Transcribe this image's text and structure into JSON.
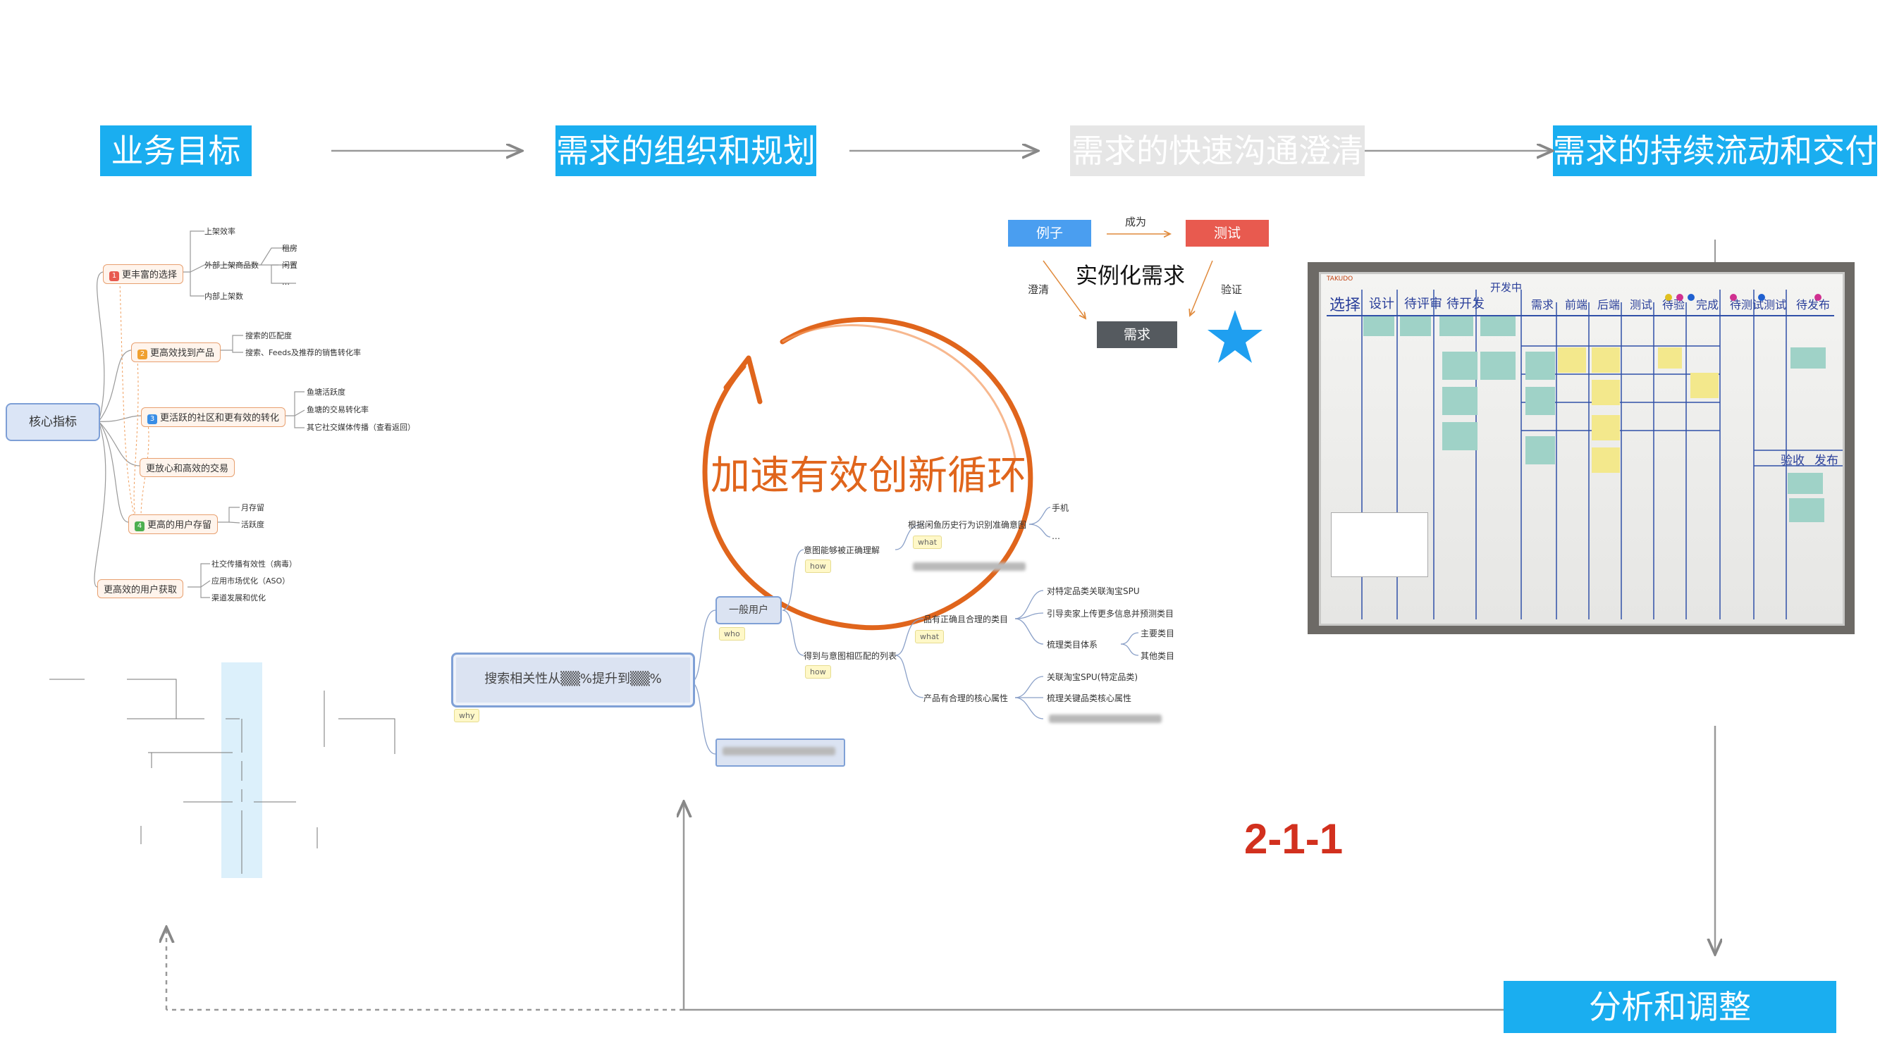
{
  "stages": {
    "s1": "业务目标",
    "s2": "需求的组织和规划",
    "s3": "需求的快速沟通澄清",
    "s4": "需求的持续流动和交付",
    "s5": "分析和调整"
  },
  "cycle_label": "加速有效创新循环",
  "slide_number": "2-1-1",
  "mindmap1": {
    "root": "核心指标",
    "branches": [
      {
        "num": "1",
        "label": "更丰富的选择"
      },
      {
        "num": "2",
        "label": "更高效找到产品"
      },
      {
        "num": "3",
        "label": "更活跃的社区和更有效的转化"
      },
      {
        "num": "",
        "label": "更放心和高效的交易"
      },
      {
        "num": "4",
        "label": "更高的用户存留"
      },
      {
        "num": "",
        "label": "更高效的用户获取"
      }
    ],
    "leaves": {
      "b1": [
        "上架效率",
        "外部上架商品数",
        "内部上架数"
      ],
      "b1_sub": [
        "租房",
        "闲置",
        "…"
      ],
      "b2": [
        "搜索的匹配度",
        "搜索、Feeds及推荐的销售转化率"
      ],
      "b3": [
        "鱼塘活跃度",
        "鱼塘的交易转化率",
        "其它社交媒体传播（查看返回）"
      ],
      "b5": [
        "月存留",
        "活跃度"
      ],
      "b6": [
        "社交传播有效性（病毒）",
        "应用市场优化（ASO）",
        "渠道发展和优化"
      ]
    }
  },
  "sbe": {
    "example": "例子",
    "test": "测试",
    "requirement": "需求",
    "center": "实例化需求",
    "become": "成为",
    "clarify": "澄清",
    "verify": "验证"
  },
  "mindmap2": {
    "root": "搜索相关性从▒▒%提升到▒▒%",
    "why": "why",
    "user": "一般用户",
    "who": "who",
    "intent_1": "意图能够被正确理解",
    "how": "how",
    "intent_2": "得到与意图相匹配的列表",
    "history": "根据闲鱼历史行为识别准确意图",
    "what": "what",
    "phone": "手机",
    "ellipsis": "…",
    "category": "品有正确且合理的类目",
    "spu": "对特定品类关联淘宝SPU",
    "guide": "引导卖家上传更多信息并预测类目",
    "sort": "梳理类目体系",
    "main_cat": "主要类目",
    "other_cat": "其他类目",
    "core_attr": "产品有合理的核心属性",
    "spu2": "关联淘宝SPU(特定品类)",
    "key_attr": "梳理关键品类核心属性"
  },
  "kanban": {
    "brand": "TAKUDO",
    "columns": [
      "选择",
      "设计",
      "待评审",
      "待开发",
      "开发中",
      "需求",
      "前端",
      "后端",
      "测试",
      "待验",
      "完成",
      "待测试",
      "测试",
      "待发布"
    ],
    "in_progress": "开发中",
    "accept": "验收",
    "release": "发布"
  },
  "colors": {
    "accent_blue": "#1aaef0",
    "example_blue": "#4a9ef0",
    "test_red": "#e85a4f",
    "req_grey": "#555a5f",
    "cycle_orange": "#e0651c",
    "slide_number_red": "#d2301e"
  }
}
